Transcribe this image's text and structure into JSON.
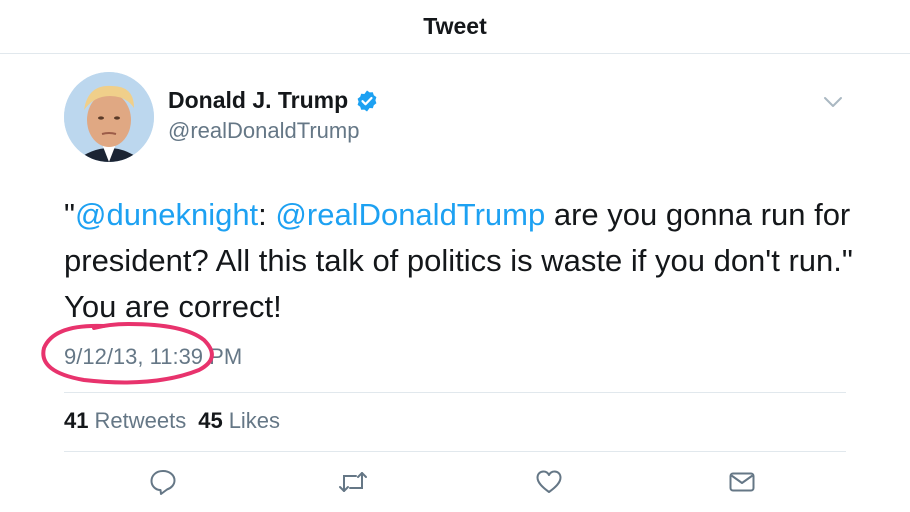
{
  "header": {
    "title": "Tweet"
  },
  "author": {
    "name": "Donald J. Trump",
    "handle": "@realDonaldTrump",
    "verified": true
  },
  "tweet": {
    "quote_open": "\"",
    "mention_1": "@duneknight",
    "sep": ": ",
    "mention_2": "@realDonaldTrump",
    "text": " are you gonna run for president? All this talk of politics is waste if you don't run.\" You are correct!"
  },
  "timestamp": "9/12/13, 11:39 PM",
  "stats": {
    "retweets_count": "41",
    "retweets_label": "Retweets",
    "likes_count": "45",
    "likes_label": "Likes"
  },
  "actions": [
    "reply-icon",
    "retweet-icon",
    "like-icon",
    "dm-icon"
  ],
  "colors": {
    "accent": "#1da1f2",
    "secondary_text": "#657786",
    "annotation": "#e8336d"
  }
}
